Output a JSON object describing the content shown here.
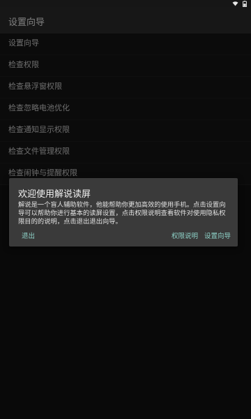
{
  "toolbar": {
    "title": "设置向导"
  },
  "list": {
    "items": [
      {
        "label": "设置向导"
      },
      {
        "label": "检查权限"
      },
      {
        "label": "检查悬浮窗权限"
      },
      {
        "label": "检查忽略电池优化"
      },
      {
        "label": "检查通知显示权限"
      },
      {
        "label": "检查文件管理权限"
      },
      {
        "label": "检查闹钟与提醒权限"
      }
    ]
  },
  "dialog": {
    "title": "欢迎使用解说读屏",
    "message": "解说是一个盲人辅助软件，他能帮助你更加高效的使用手机。点击设置向导可以帮助你进行基本的读屏设置，点击权限说明查看软件对使用隐私权限目的的说明，点击退出退出向导。",
    "buttons": {
      "exit": "退出",
      "permissions": "权限说明",
      "setup": "设置向导"
    }
  },
  "colors": {
    "accent": "#8ed2c8",
    "dialog_bg": "#3a3a3a",
    "toolbar_bg": "#2a2a2a"
  }
}
